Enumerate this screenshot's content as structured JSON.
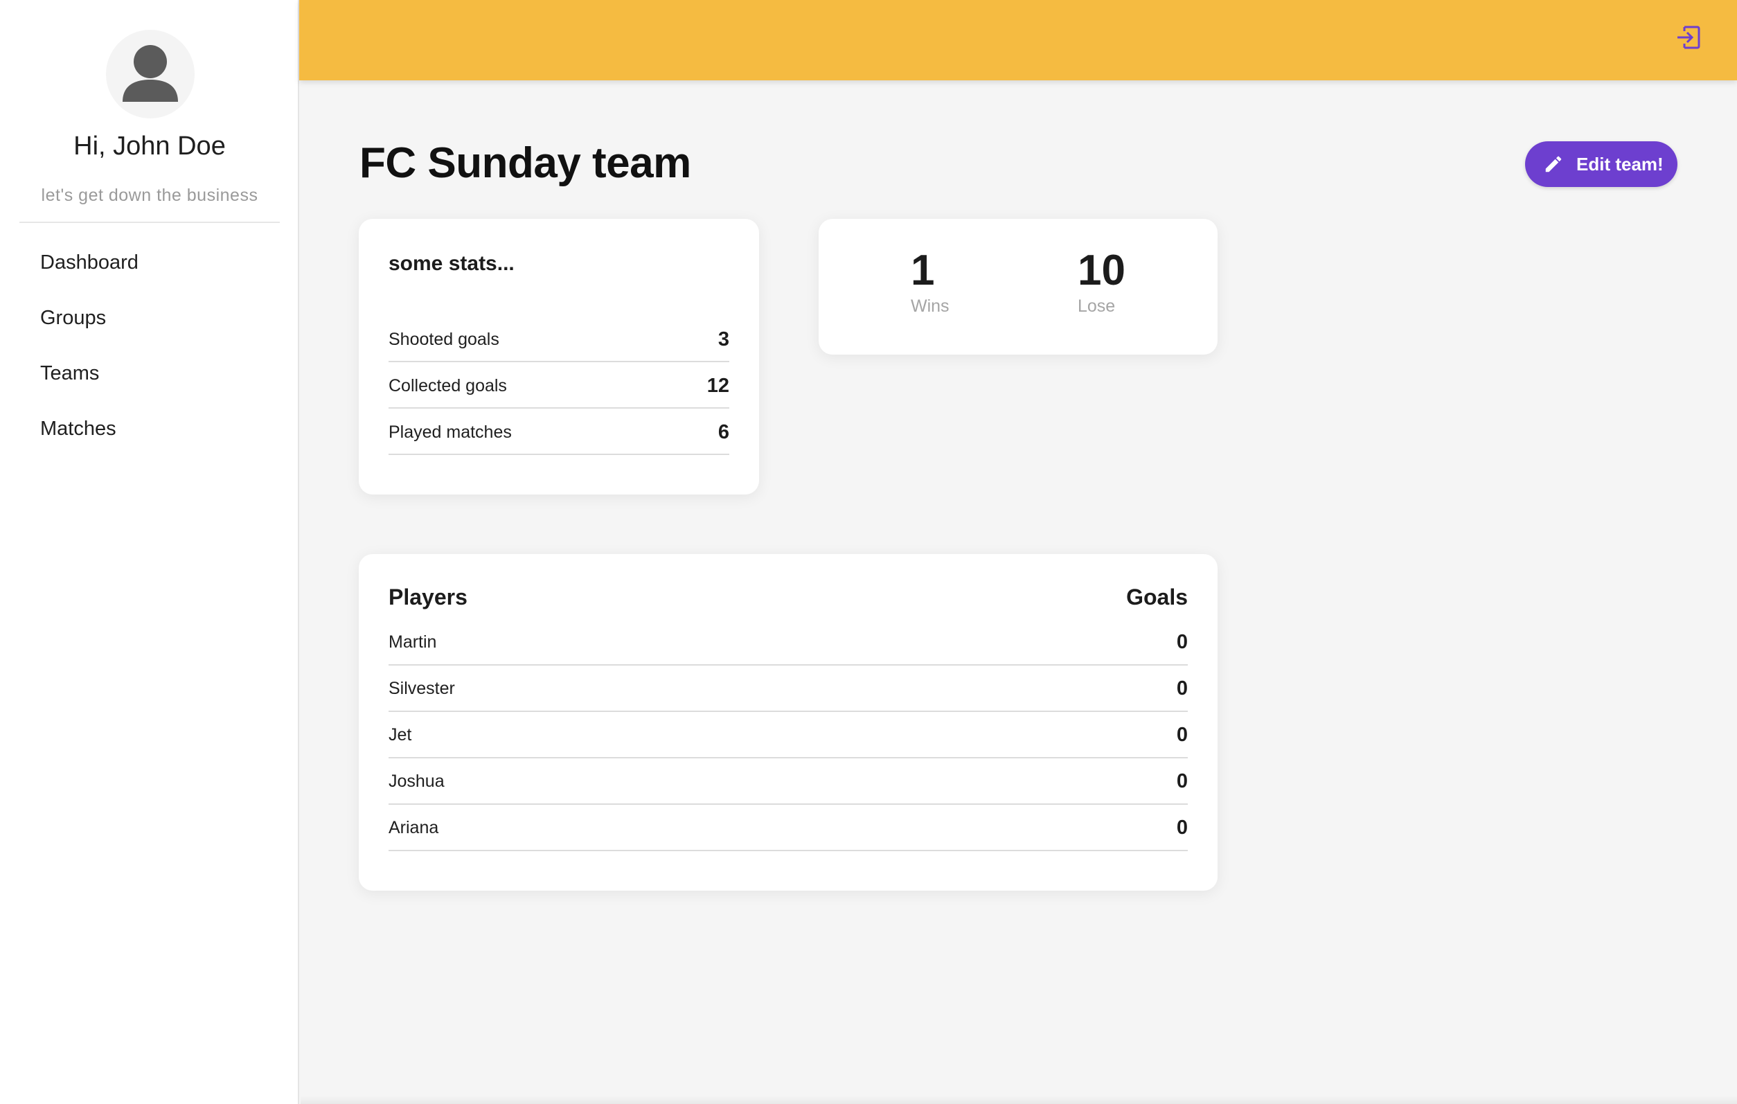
{
  "sidebar": {
    "greeting": "Hi, John Doe",
    "tagline": "let's get down the business",
    "nav": [
      {
        "label": "Dashboard"
      },
      {
        "label": "Groups"
      },
      {
        "label": "Teams"
      },
      {
        "label": "Matches"
      }
    ]
  },
  "topbar": {
    "icon": "logout-icon",
    "accent_color": "#f5bb41"
  },
  "main": {
    "title": "FC Sunday team",
    "edit_button": {
      "label": "Edit team!",
      "icon": "pencil-icon",
      "color": "#6d3fcf"
    },
    "stats": {
      "title": "some stats...",
      "rows": [
        {
          "label": "Shooted goals",
          "value": "3"
        },
        {
          "label": "Collected goals",
          "value": "12"
        },
        {
          "label": "Played matches",
          "value": "6"
        }
      ]
    },
    "record": {
      "wins": {
        "value": "1",
        "label": "Wins"
      },
      "lose": {
        "value": "10",
        "label": "Lose"
      }
    },
    "players": {
      "header_players": "Players",
      "header_goals": "Goals",
      "rows": [
        {
          "name": "Martin",
          "goals": "0"
        },
        {
          "name": "Silvester",
          "goals": "0"
        },
        {
          "name": "Jet",
          "goals": "0"
        },
        {
          "name": "Joshua",
          "goals": "0"
        },
        {
          "name": "Ariana",
          "goals": "0"
        }
      ]
    }
  }
}
